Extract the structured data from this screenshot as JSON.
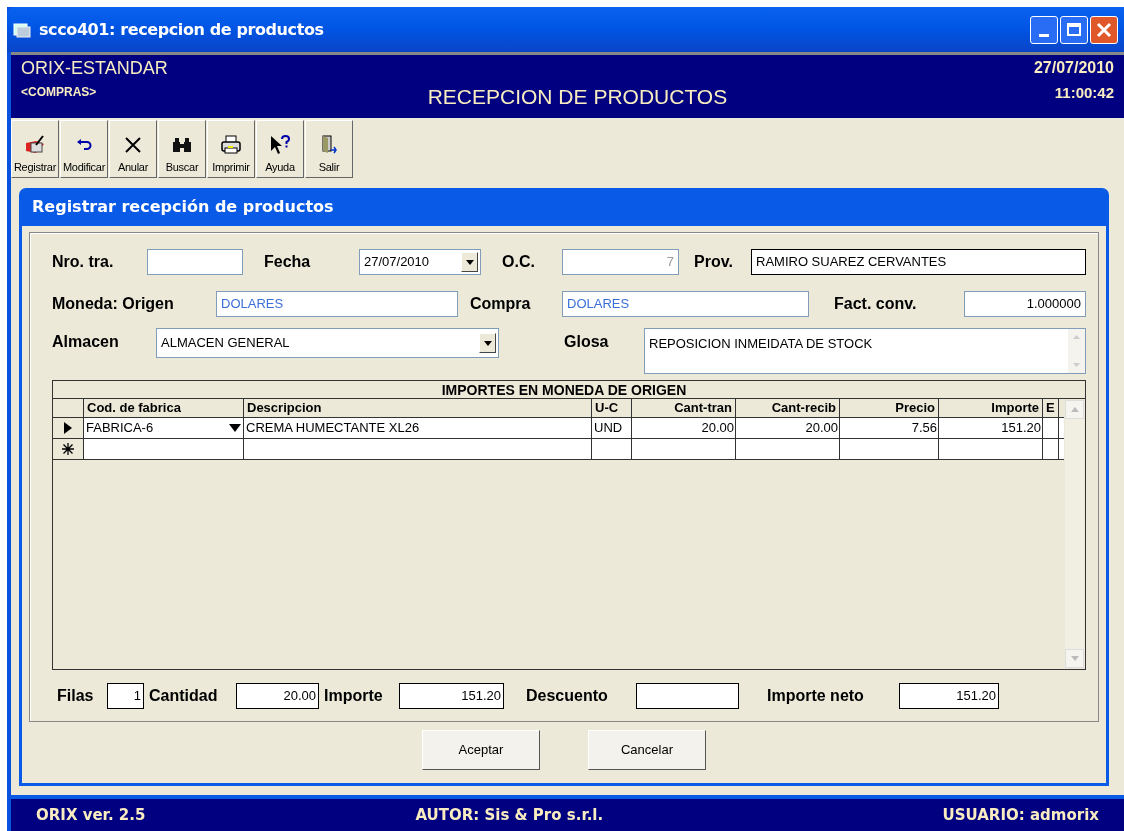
{
  "window": {
    "title": "scco401: recepcion de productos"
  },
  "header": {
    "app": "ORIX-ESTANDAR",
    "module": "<COMPRAS>",
    "title": "RECEPCION DE PRODUCTOS",
    "date": "27/07/2010",
    "time": "11:00:42"
  },
  "toolbar": [
    {
      "label": "Registrar",
      "kind": "register"
    },
    {
      "label": "Modificar",
      "kind": "undo"
    },
    {
      "label": "Anular",
      "kind": "cancel"
    },
    {
      "label": "Buscar",
      "kind": "search"
    },
    {
      "label": "Imprimir",
      "kind": "print"
    },
    {
      "label": "Ayuda",
      "kind": "help"
    },
    {
      "label": "Salir",
      "kind": "exit"
    }
  ],
  "dialog": {
    "title": "Registrar recepción de productos",
    "fields": {
      "nro_tra": {
        "label": "Nro. tra."
      },
      "fecha": {
        "label": "Fecha",
        "value": "27/07/2010"
      },
      "oc": {
        "label": "O.C.",
        "value": "7",
        "disabled": true
      },
      "prov": {
        "label": "Prov.",
        "value": "RAMIRO SUAREZ CERVANTES"
      },
      "moneda_origen": {
        "label": "Moneda: Origen",
        "value": "DOLARES"
      },
      "compra": {
        "label": "Compra",
        "value": "DOLARES"
      },
      "fact_conv": {
        "label": "Fact. conv.",
        "value": "1.000000"
      },
      "almacen": {
        "label": "Almacen",
        "value": "ALMACEN GENERAL"
      },
      "glosa": {
        "label": "Glosa",
        "value": "REPOSICION INMEIDATA DE STOCK"
      }
    },
    "grid": {
      "caption": "IMPORTES EN MONEDA DE ORIGEN",
      "columns": [
        "Cod. de fabrica",
        "Descripcion",
        "U-C",
        "Cant-tran",
        "Cant-recib",
        "Precio",
        "Importe",
        "E"
      ],
      "rows": [
        {
          "kind": "data",
          "selected": true,
          "cells": [
            "FABRICA-6",
            "CREMA HUMECTANTE XL26",
            "UND",
            "20.00",
            "20.00",
            "7.56",
            "151.20",
            ""
          ]
        },
        {
          "kind": "new",
          "selected": false
        }
      ]
    },
    "totals": [
      {
        "label": "Filas",
        "value": "1"
      },
      {
        "label": "Cantidad",
        "value": "20.00"
      },
      {
        "label": "Importe",
        "value": "151.20"
      },
      {
        "label": "Descuento"
      },
      {
        "label": "Importe neto",
        "value": "151.20"
      }
    ],
    "buttons": [
      "Aceptar",
      "Cancelar"
    ]
  },
  "status_bar": {
    "version": "ORIX ver. 2.5",
    "author": "AUTOR: Sis & Pro s.r.l.",
    "user": "USUARIO: admorix"
  }
}
